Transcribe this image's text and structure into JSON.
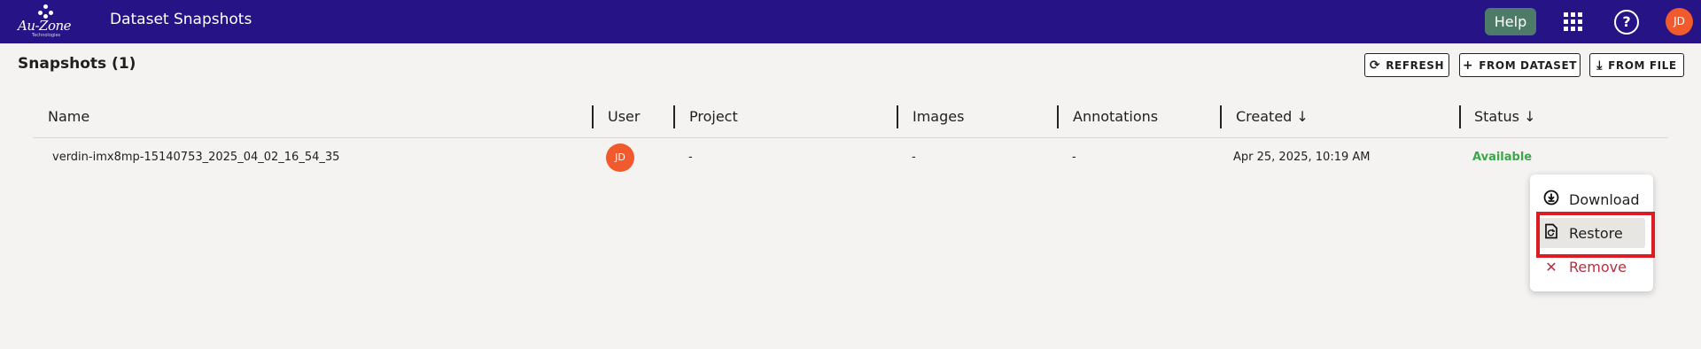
{
  "header": {
    "logo_text": "Au-Zone",
    "logo_tagline": "Technologies",
    "title": "Dataset Snapshots",
    "help_label": "Help",
    "apps_icon": "apps-grid-icon",
    "help_icon": "question-circle-icon",
    "user_initials": "JD"
  },
  "page": {
    "title": "Snapshots (1)",
    "buttons": [
      {
        "label": "REFRESH",
        "icon": "refresh-icon"
      },
      {
        "label": "FROM DATASET",
        "icon": "plus-icon"
      },
      {
        "label": "FROM FILE",
        "icon": "download-icon"
      }
    ]
  },
  "table": {
    "columns": [
      "Name",
      "User",
      "Project",
      "Images",
      "Annotations",
      "Created ↓",
      "Status ↓"
    ],
    "rows": [
      {
        "name": "verdin-imx8mp-15140753_2025_04_02_16_54_35",
        "user": "JD",
        "project": "-",
        "images": "-",
        "annotations": "-",
        "created": "Apr 25, 2025, 10:19 AM",
        "status": "Available"
      }
    ]
  },
  "context_menu": {
    "items": [
      {
        "label": "Download",
        "icon": "download-circle-icon"
      },
      {
        "label": "Restore",
        "icon": "restore-icon"
      },
      {
        "label": "Remove",
        "icon": "close-icon"
      }
    ]
  },
  "colors": {
    "topbar": "#261486",
    "help_button": "#4e7a68",
    "avatar": "#f05a2d",
    "status_available": "#3da64a",
    "remove": "#b33040",
    "highlight": "#dc1c22"
  }
}
